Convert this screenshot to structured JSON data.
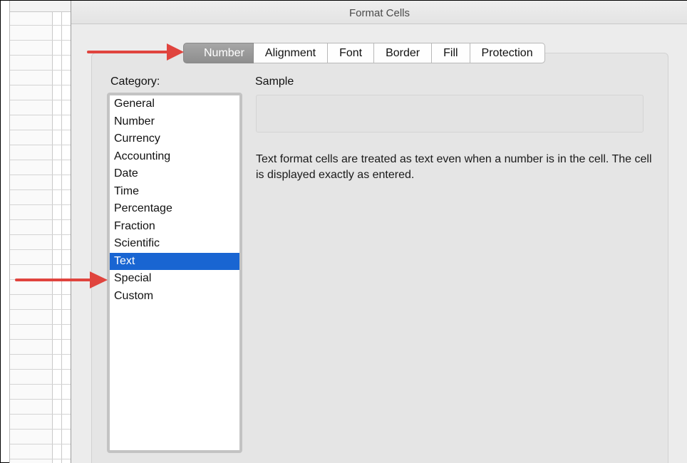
{
  "dialog": {
    "title": "Format Cells",
    "tabs": [
      {
        "label": "Number",
        "active": true
      },
      {
        "label": "Alignment",
        "active": false
      },
      {
        "label": "Font",
        "active": false
      },
      {
        "label": "Border",
        "active": false
      },
      {
        "label": "Fill",
        "active": false
      },
      {
        "label": "Protection",
        "active": false
      }
    ]
  },
  "category": {
    "label": "Category:",
    "items": [
      "General",
      "Number",
      "Currency",
      "Accounting",
      "Date",
      "Time",
      "Percentage",
      "Fraction",
      "Scientific",
      "Text",
      "Special",
      "Custom"
    ],
    "selected": "Text"
  },
  "sample": {
    "label": "Sample",
    "value": ""
  },
  "description": "Text format cells are treated as text even when a number is in the cell.  The cell is displayed exactly as entered.",
  "colors": {
    "selection": "#1965d2",
    "annotation_arrow": "#e0443e",
    "active_tab": "#979797"
  }
}
